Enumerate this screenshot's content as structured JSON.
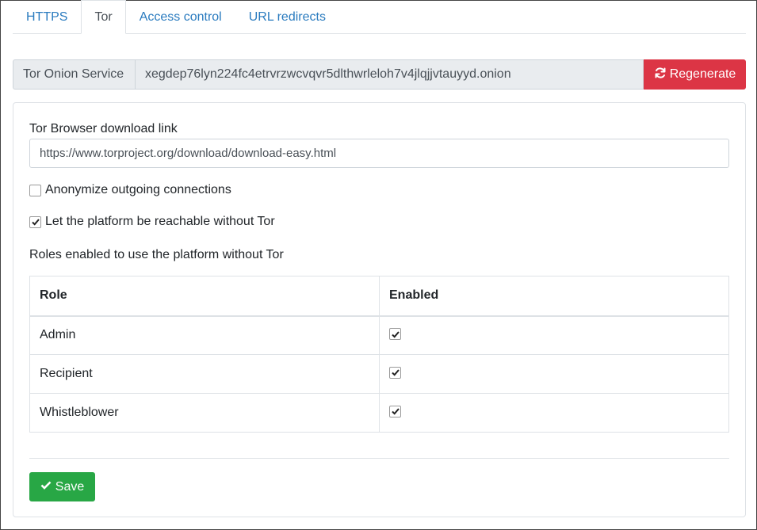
{
  "tabs": [
    {
      "label": "HTTPS",
      "active": false
    },
    {
      "label": "Tor",
      "active": true
    },
    {
      "label": "Access control",
      "active": false
    },
    {
      "label": "URL redirects",
      "active": false
    }
  ],
  "onion": {
    "label": "Tor Onion Service",
    "address": "xegdep76lyn224fc4etrvrzwcvqvr5dlthwrleloh7v4jlqjjvtauyyd.onion",
    "regenerate_label": "Regenerate",
    "regenerate_icon": "refresh-icon"
  },
  "form": {
    "download_link_label": "Tor Browser download link",
    "download_link_value": "https://www.torproject.org/download/download-easy.html",
    "anonymize_label": "Anonymize outgoing connections",
    "anonymize_checked": false,
    "reachable_label": "Let the platform be reachable without Tor",
    "reachable_checked": true,
    "roles_heading": "Roles enabled to use the platform without Tor"
  },
  "roles_table": {
    "columns": [
      "Role",
      "Enabled"
    ],
    "rows": [
      {
        "role": "Admin",
        "enabled": true
      },
      {
        "role": "Recipient",
        "enabled": true
      },
      {
        "role": "Whistleblower",
        "enabled": true
      }
    ]
  },
  "actions": {
    "save_label": "Save",
    "save_icon": "check-icon"
  },
  "colors": {
    "link": "#2a7bbf",
    "danger": "#dc3545",
    "success": "#28a745",
    "border": "#dee2e6"
  }
}
